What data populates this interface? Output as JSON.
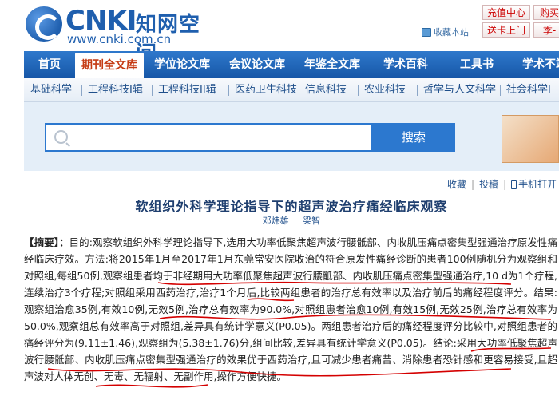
{
  "header": {
    "logo_mark": "CNKI",
    "logo_name": "知网空间",
    "logo_url": "www.cnki.com.cn",
    "bookmark_label": "收藏本站",
    "top_buttons": [
      "充值中心",
      "购买",
      "送卡上门",
      "季-"
    ]
  },
  "main_nav": {
    "items": [
      "首页",
      "期刊全文库",
      "学位论文库",
      "会议论文库",
      "年鉴全文库",
      "学术百科",
      "工具书",
      "学术不端"
    ],
    "active_index": 1
  },
  "sub_nav": {
    "items": [
      "基础科学",
      "工程科技I辑",
      "工程科技II辑",
      "医药卫生科技",
      "信息科技",
      "农业科技",
      "哲学与人文科学",
      "社会科学I辑"
    ]
  },
  "search": {
    "placeholder": "",
    "button_label": "搜索"
  },
  "actions": {
    "collect": "收藏",
    "submit": "投稿",
    "mobile": "手机打开"
  },
  "article": {
    "title": "软组织外科学理论指导下的超声波治疗痛经临床观察",
    "authors": [
      "邓炜雄",
      "梁智"
    ],
    "abstract_label": "【摘要】：",
    "abstract_text": "目的:观察软组织外科学理论指导下,选用大功率低聚焦超声波行腰骶部、内收肌压痛点密集型强通治疗原发性痛经临床疗效。方法:将2015年1月至2017年1月东莞常安医院收治的符合原发性痛经诊断的患者100例随机分为观察组和对照组,每组50例,观察组患者均于非经期用大功率低聚焦超声波行腰骶部、内收肌压痛点密集型强通治疗,10 d为1个疗程,连续治疗3个疗程;对照组采用西药治疗,治疗1个月后,比较两组患者的治疗总有效率以及治疗前后的痛经程度评分。结果:观察组治愈35例,有效10例,无效5例,治疗总有效率为90.0%,对照组患者治愈10例,有效15例,无效25例,治疗总有效率为50.0%,观察组总有效率高于对照组,差异具有统计学意义(P0.05)。两组患者治疗后的痛经程度评分比较中,对照组患者的痛经评分为(9.11±1.46),观察组为(5.38±1.76)分,组间比较,差异具有统计学意义(P0.05)。结论:采用大功率低聚焦超声波行腰骶部、内收肌压痛点密集型强通治疗的效果优于西药治疗,且可减少患者痛苦、消除患者恐针感和更容易接受,且超声波对人体无创、无毒、无辐射、无副作用,操作方便快捷。"
  },
  "colors": {
    "nav_blue": "#1f66bd",
    "active_tab_text": "#c53b14",
    "annotation_red": "#d40000"
  }
}
